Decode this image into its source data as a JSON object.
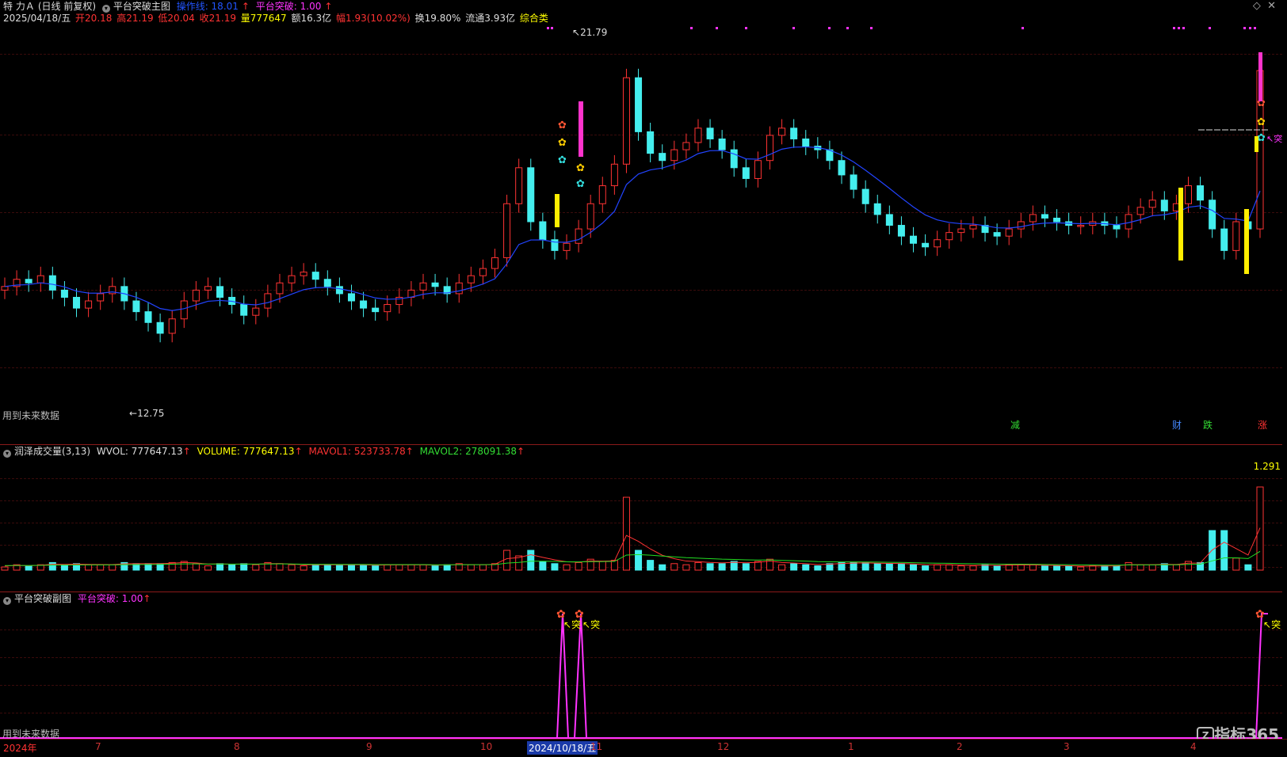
{
  "header": {
    "stock_name": "特 力Ａ",
    "adjust_mode": "(日线 前复权)",
    "indicator_name": "平台突破主图",
    "main_params": [
      {
        "label": "操作线: 18.01",
        "color": "#2255ff"
      },
      {
        "label": "平台突破: 1.00",
        "color": "#ff33ff"
      }
    ]
  },
  "quote": {
    "date": "2025/04/18/五",
    "open": "开20.18",
    "high": "高21.19",
    "low": "低20.04",
    "close": "收21.19",
    "volume": "量777647",
    "amount": "额16.3亿",
    "change": "幅1.93(10.02%)",
    "turnover": "换19.80%",
    "float_cap": "流通3.93亿",
    "category": "综合类"
  },
  "main_chart": {
    "high_label": "21.79",
    "low_label": "12.75",
    "future_data_note": "用到未来数据",
    "markers": [
      "减",
      "财",
      "跌",
      "涨"
    ],
    "tag_tu": "突",
    "y_range": [
      11.5,
      22.5
    ]
  },
  "volume_panel": {
    "title": "润泽成交量(3,13)",
    "wvol": "WVOL: 777647.13",
    "volume": "VOLUME: 777647.13",
    "mavol1": "MAVOL1: 523733.78",
    "mavol2": "MAVOL2: 278091.38",
    "right_value": "1.291",
    "colors": {
      "wvol": "#dddddd",
      "volume": "#ffff00",
      "mavol1": "#ff3333",
      "mavol2": "#33dd33"
    }
  },
  "sub_panel": {
    "title": "平台突破副图",
    "value": "平台突破: 1.00",
    "future_data_note": "用到未来数据",
    "signal_label": "突"
  },
  "time_axis": {
    "labels": [
      "2024年",
      "7",
      "8",
      "9",
      "10",
      "2024/10/18/五",
      "11",
      "12",
      "1",
      "2",
      "3",
      "4"
    ]
  },
  "watermark": "指标365",
  "chart_data": {
    "type": "candlestick",
    "series": [
      {
        "name": "K线",
        "values": [
          15.2,
          15.4,
          15.3,
          15.5,
          15.1,
          14.9,
          14.6,
          14.8,
          15.0,
          15.2,
          14.8,
          14.5,
          14.2,
          13.9,
          14.3,
          14.8,
          15.1,
          15.2,
          14.9,
          14.7,
          14.4,
          14.6,
          15.0,
          15.3,
          15.5,
          15.6,
          15.4,
          15.2,
          15.0,
          14.8,
          14.6,
          14.5,
          14.7,
          14.9,
          15.1,
          15.3,
          15.2,
          15.0,
          15.3,
          15.5,
          15.7,
          16.0,
          17.5,
          18.5,
          17.0,
          16.5,
          16.2,
          16.4,
          16.8,
          17.5,
          18.0,
          18.6,
          21.0,
          19.5,
          18.9,
          18.7,
          19.0,
          19.2,
          19.6,
          19.3,
          19.0,
          18.5,
          18.2,
          18.7,
          19.4,
          19.6,
          19.3,
          19.1,
          19.0,
          18.7,
          18.3,
          17.9,
          17.5,
          17.2,
          16.9,
          16.6,
          16.4,
          16.3,
          16.5,
          16.7,
          16.8,
          16.9,
          16.7,
          16.6,
          16.8,
          17.0,
          17.2,
          17.1,
          17.0,
          16.9,
          16.9,
          17.0,
          16.9,
          16.8,
          17.2,
          17.4,
          17.6,
          17.3,
          17.5,
          18.0,
          17.6,
          16.8,
          16.2,
          17.0,
          16.8,
          21.2
        ]
      }
    ],
    "annotations": [
      "21.79",
      "12.75"
    ],
    "volume_series": {
      "name": "VOLUME",
      "last": 777647.13
    },
    "mavol1_last": 523733.78,
    "mavol2_last": 278091.38,
    "signal_points": [
      "2024/10/18",
      "2024/10/22",
      "2025/04/18"
    ]
  }
}
